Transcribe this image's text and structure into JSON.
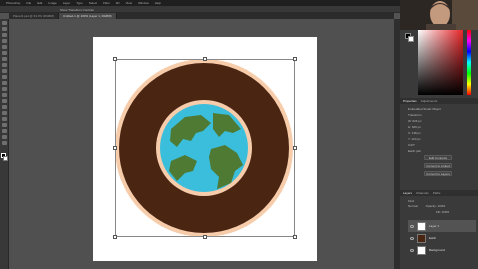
{
  "menubar": {
    "items": [
      "Photoshop",
      "File",
      "Edit",
      "Image",
      "Layer",
      "Type",
      "Select",
      "Filter",
      "3D",
      "View",
      "Window",
      "Help"
    ]
  },
  "tabs": [
    {
      "label": "Planet3.psd @ 33.3% (RGB/8)"
    },
    {
      "label": "Untitled-1 @ 100% (Layer 1, RGB/8)"
    }
  ],
  "options_bar": {
    "show_transform_controls": "Show Transform Controls"
  },
  "properties": {
    "tabs": [
      "Properties",
      "Adjustments"
    ],
    "header": "Embedded Smart Object",
    "transform_label": "Transform",
    "w": "W: 626 px",
    "h": "H: 626 px",
    "x": "X: 138 px",
    "y": "Y: 123 px",
    "angle": "0.00°",
    "file_label": "Earth.psb",
    "buttons": [
      "Edit Contents",
      "Convert to Linked",
      "Convert to Layers"
    ]
  },
  "layers": {
    "tabs": [
      "Layers",
      "Channels",
      "Paths"
    ],
    "kind_label": "Kind",
    "mode": "Normal",
    "opacity": "Opacity: 100%",
    "fill": "Fill: 100%",
    "items": [
      {
        "name": "Layer 1"
      },
      {
        "name": "Earth"
      },
      {
        "name": "Background"
      }
    ]
  },
  "colors": {
    "ring": "#4a2512",
    "ring_edge": "#f7ccaa",
    "ocean": "#3bbedb",
    "land": "#4e7a34",
    "accent": "#e7262a"
  }
}
